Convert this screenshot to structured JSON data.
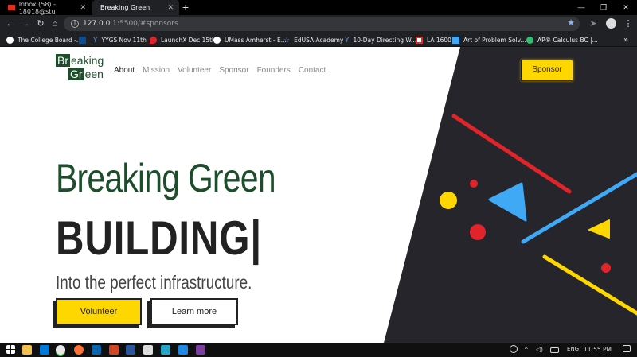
{
  "browser": {
    "tabs": [
      {
        "label": "Inbox (58) - 18018@stu",
        "active": false
      },
      {
        "label": "Breaking Green",
        "active": true
      }
    ],
    "new_tab_label": "+",
    "url_host": "127.0.0.1",
    "url_path": ":5500/#sponsors",
    "bookmarks": [
      {
        "label": "The College Board -..."
      },
      {
        "label": "YYGS Nov 11th"
      },
      {
        "label": "LaunchX Dec 15th"
      },
      {
        "label": "UMass Amherst - E..."
      },
      {
        "label": "EdUSA Academy"
      },
      {
        "label": "10-Day Directing W..."
      },
      {
        "label": "LA 1600"
      },
      {
        "label": "Art of Problem Solv..."
      },
      {
        "label": "AP® Calculus BC |..."
      }
    ],
    "bookmarks_overflow": "»"
  },
  "site": {
    "logo_line1_box": "Br",
    "logo_line1_rest": "eaking",
    "logo_line2_box": "Gr",
    "logo_line2_rest": "een",
    "nav": [
      {
        "label": "About",
        "active": true
      },
      {
        "label": "Mission",
        "active": false
      },
      {
        "label": "Volunteer",
        "active": false
      },
      {
        "label": "Sponsor",
        "active": false
      },
      {
        "label": "Founders",
        "active": false
      },
      {
        "label": "Contact",
        "active": false
      }
    ],
    "sponsor_button": "Sponsor",
    "hero_title": "Breaking Green",
    "hero_word": "BUILDING|",
    "hero_subtitle": "Into the perfect infrastructure.",
    "volunteer_button": "Volunteer",
    "learn_more_button": "Learn more"
  },
  "taskbar": {
    "lang": "ENG",
    "time": "11:55 PM"
  },
  "colors": {
    "brand_green": "#1e4d2b",
    "accent_yellow": "#ffd700",
    "panel_dark": "#25252b",
    "shape_red": "#e0242a",
    "shape_blue": "#3fa9f5"
  }
}
